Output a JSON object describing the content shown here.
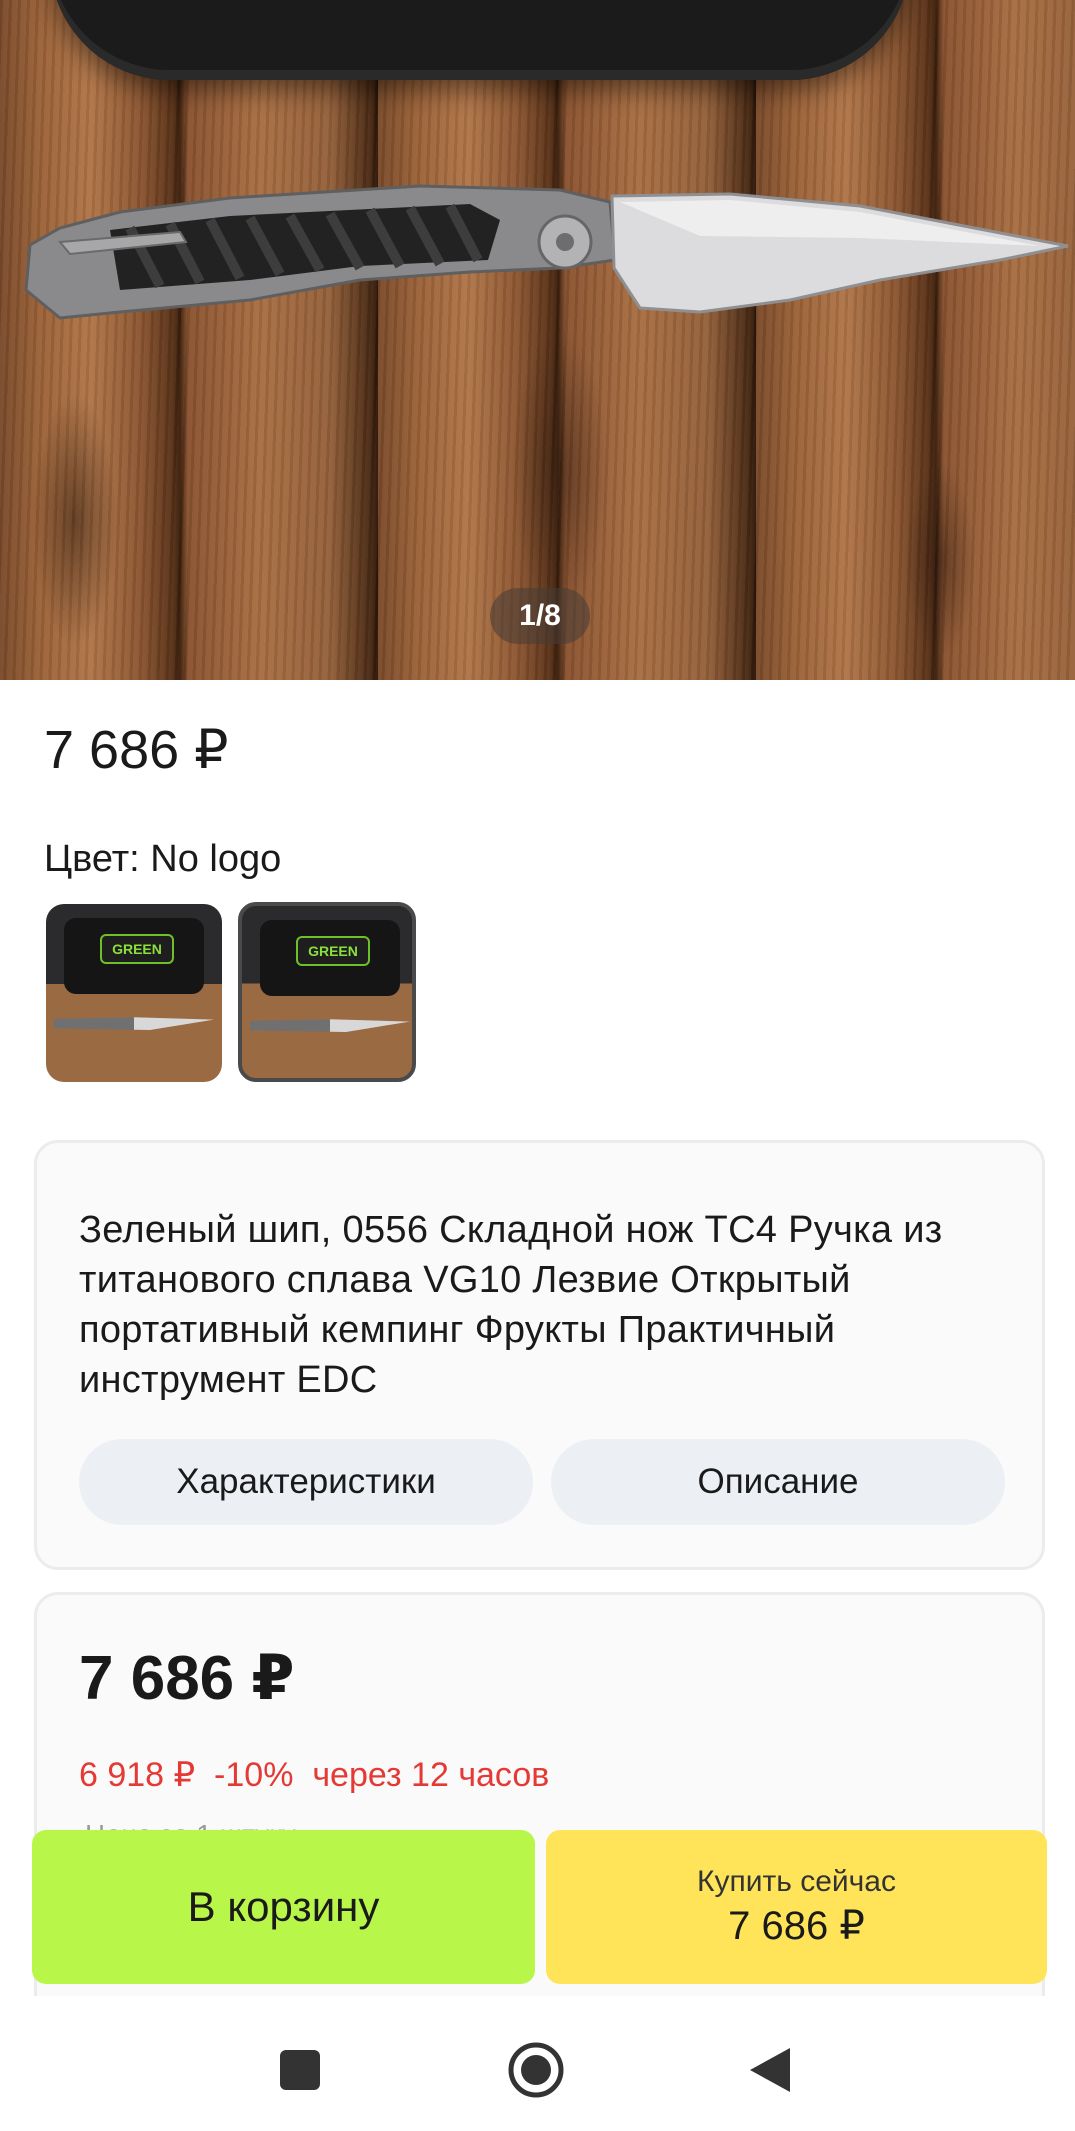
{
  "gallery": {
    "counter": "1/8"
  },
  "product": {
    "price": "7 686 ₽",
    "color_label": "Цвет: No logo",
    "swatches": [
      {
        "logo_text": "GREEN"
      },
      {
        "logo_text": "GREEN"
      }
    ],
    "title": "Зеленый шип, 0556 Складной нож TC4 Ручка из титанового сплава VG10 Лезвие Открытый портативный кемпинг Фрукты Практичный инструмент EDC",
    "tabs": {
      "specs": "Характеристики",
      "description": "Описание"
    }
  },
  "pricing": {
    "price": "7 686 ₽",
    "discount_line": "6 918 ₽  -10%  через 12 часов",
    "unit_note": "Цена за 1 штуку"
  },
  "actions": {
    "cart_label": "В корзину",
    "buy_label": "Купить сейчас",
    "buy_price": "7 686 ₽"
  },
  "colors": {
    "cart_button": "#b9f64a",
    "buy_button": "#ffe45a",
    "discount": "#e53935"
  }
}
